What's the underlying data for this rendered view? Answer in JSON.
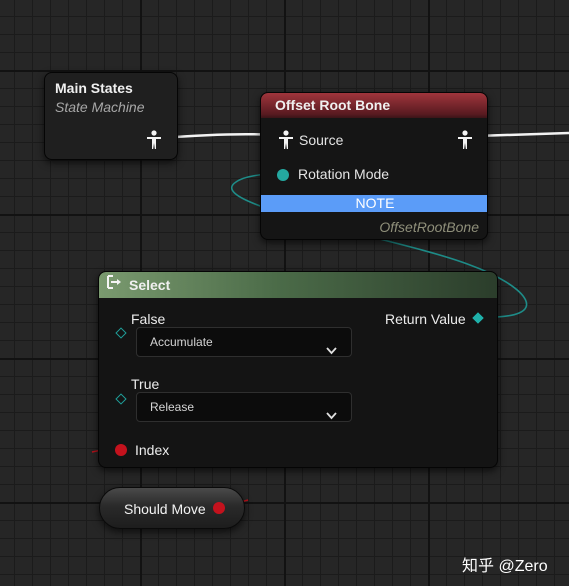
{
  "nodes": {
    "main_states": {
      "title": "Main States",
      "subtitle": "State Machine"
    },
    "offset_root_bone": {
      "title": "Offset Root Bone",
      "source_label": "Source",
      "rotation_mode_label": "Rotation Mode",
      "note_label": "NOTE",
      "footer": "OffsetRootBone"
    },
    "select": {
      "title": "Select",
      "false_label": "False",
      "false_value": "Accumulate",
      "true_label": "True",
      "true_value": "Release",
      "index_label": "Index",
      "return_value_label": "Return Value"
    },
    "should_move": {
      "label": "Should Move"
    }
  },
  "watermark": "知乎 @Zero",
  "colors": {
    "canvas": "#262626",
    "offset_root_header": "#a0353c",
    "select_header": "#7a9a6f",
    "note_bar": "#5b9cf8",
    "enum_pin": "#24a8a0",
    "bool_pin": "#c4121d",
    "exec_wire": "#ffffff"
  }
}
